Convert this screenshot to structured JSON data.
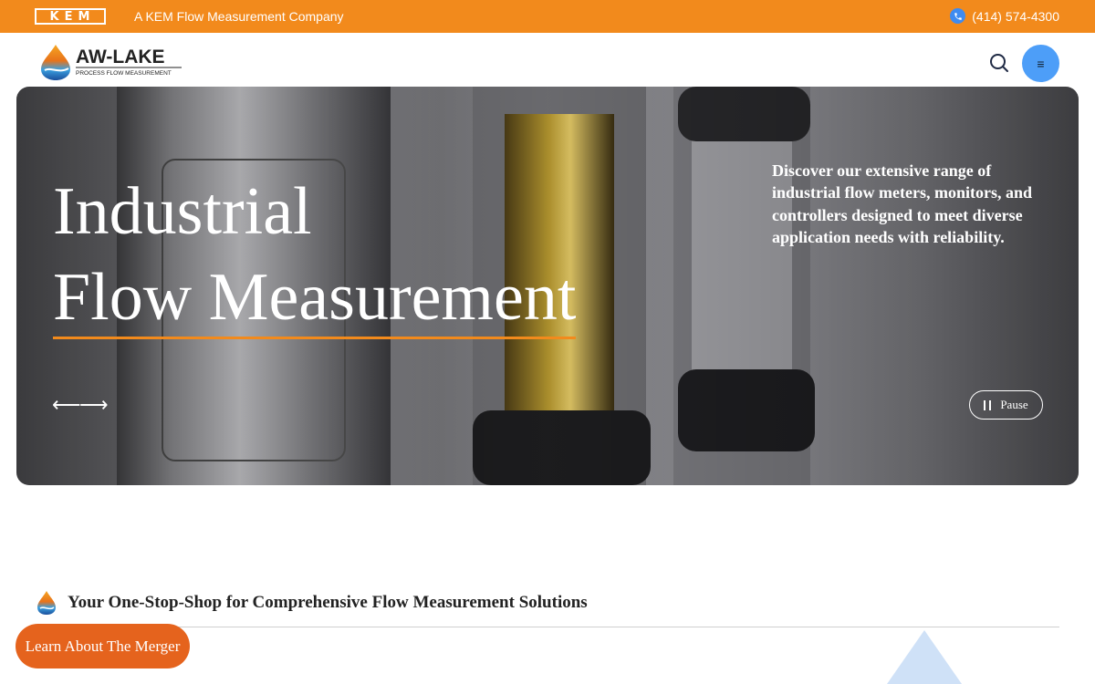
{
  "topbar": {
    "kem_logo_text": "KEM",
    "tagline": "A KEM Flow Measurement Company",
    "phone": "(414) 574-4300"
  },
  "header": {
    "logo_name": "AW-LAKE",
    "logo_sub": "PROCESS FLOW MEASUREMENT",
    "menu_icon": "≡"
  },
  "hero": {
    "title_line1": "Industrial",
    "title_line2": "Flow Measurement",
    "description": "Discover our extensive range of industrial flow meters, monitors, and controllers designed to meet diverse application needs with reliability.",
    "prev_arrow": "⟵",
    "next_arrow": "⟶",
    "pause_label": "Pause"
  },
  "section": {
    "title": "Your One-Stop-Shop for Comprehensive Flow Measurement Solutions"
  },
  "merger_button": "Learn About The Merger",
  "colors": {
    "brand_orange": "#f28a1c",
    "cta_orange": "#e5631d",
    "menu_blue": "#4d9ef8"
  }
}
